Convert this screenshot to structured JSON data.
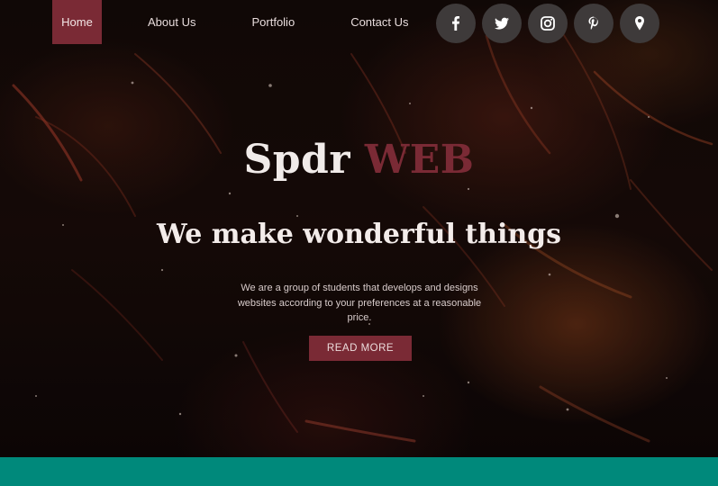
{
  "nav": {
    "items": [
      {
        "label": "Home",
        "active": true
      },
      {
        "label": "About Us",
        "active": false
      },
      {
        "label": "Portfolio",
        "active": false
      },
      {
        "label": "Contact Us",
        "active": false
      }
    ]
  },
  "social": [
    {
      "icon": "facebook-icon"
    },
    {
      "icon": "twitter-icon"
    },
    {
      "icon": "instagram-icon"
    },
    {
      "icon": "pinterest-icon"
    },
    {
      "icon": "location-pin-icon"
    }
  ],
  "hero": {
    "brand_main": "Spdr",
    "brand_accent": "WEB",
    "tagline": "We make wonderful things",
    "description": "We are a group of students that develops and designs websites according to your preferences at a reasonable price.",
    "cta_label": "READ MORE"
  },
  "colors": {
    "accent": "#7a2a35",
    "footer_band": "#00897b",
    "social_button": "#3e3a3a"
  }
}
